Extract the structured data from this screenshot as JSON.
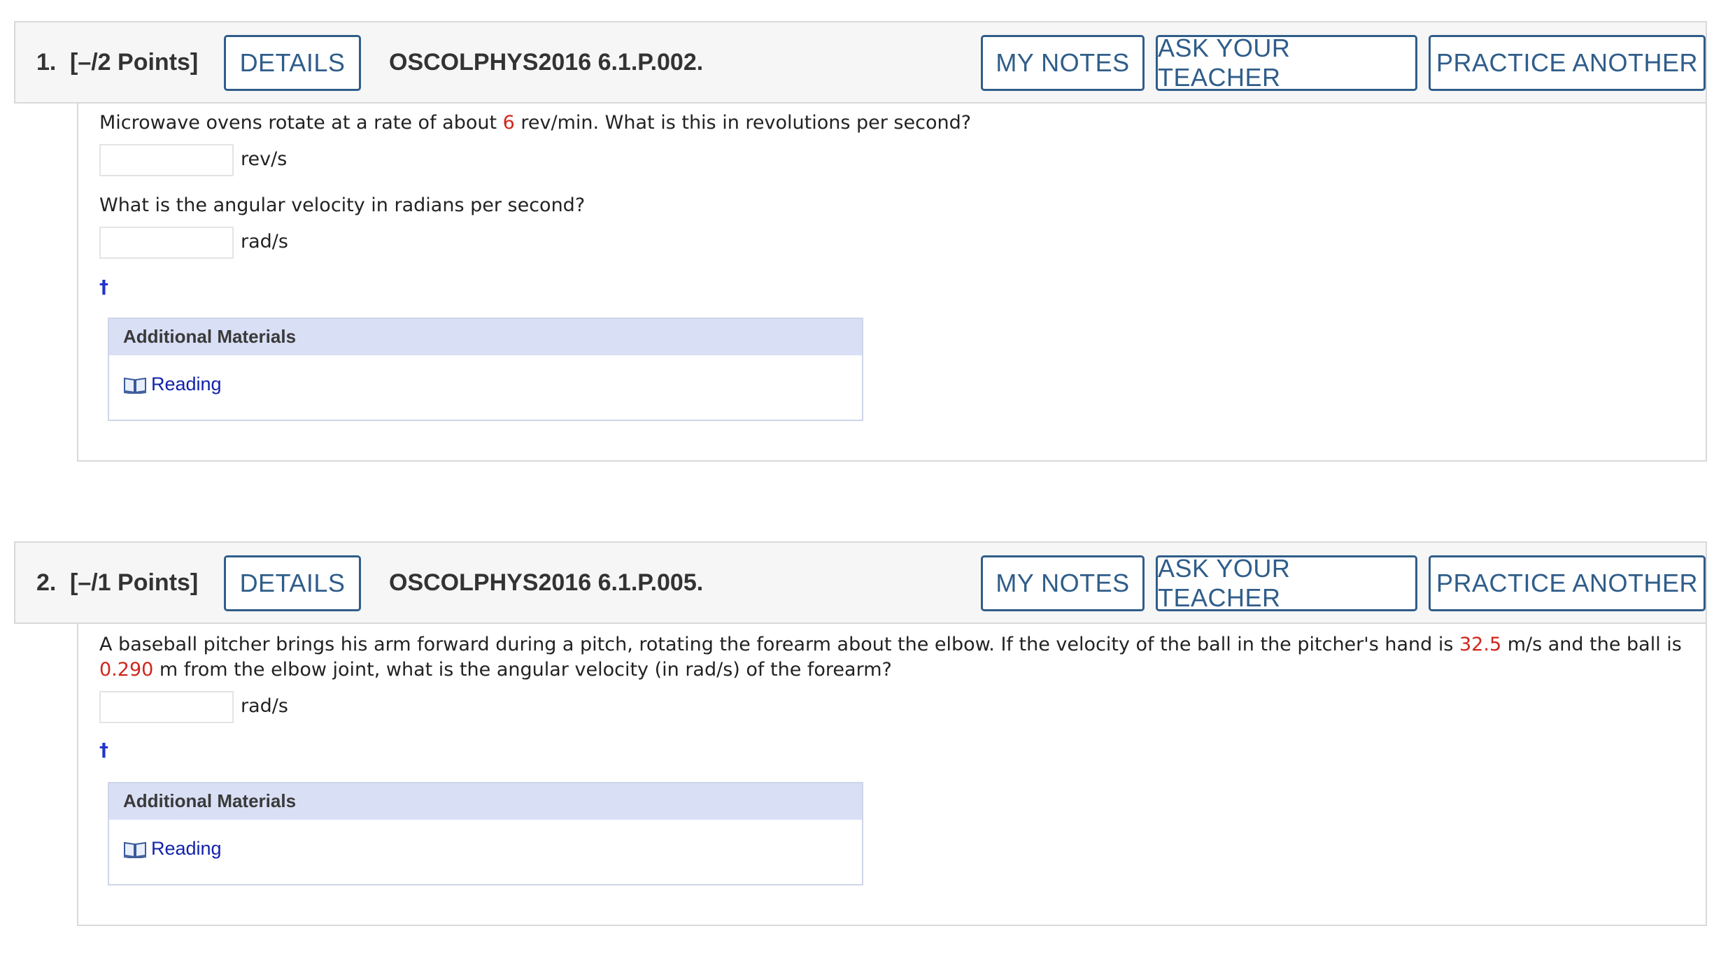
{
  "questions": [
    {
      "number": "1.",
      "points": "[–/2 Points]",
      "details_label": "DETAILS",
      "code": "OSCOLPHYS2016 6.1.P.002.",
      "my_notes_label": "MY NOTES",
      "ask_teacher_label": "ASK YOUR TEACHER",
      "practice_label": "PRACTICE ANOTHER",
      "prompt1": {
        "before": "Microwave ovens rotate at a rate of about ",
        "value": "6",
        "after": " rev/min. What is this in revolutions per second?"
      },
      "input1": {
        "value": "",
        "unit": "rev/s"
      },
      "prompt2": "What is the angular velocity in radians per second?",
      "input2": {
        "value": "",
        "unit": "rad/s"
      },
      "dagger": "†",
      "materials_title": "Additional Materials",
      "reading_label": "Reading"
    },
    {
      "number": "2.",
      "points": "[–/1 Points]",
      "details_label": "DETAILS",
      "code": "OSCOLPHYS2016 6.1.P.005.",
      "my_notes_label": "MY NOTES",
      "ask_teacher_label": "ASK YOUR TEACHER",
      "practice_label": "PRACTICE ANOTHER",
      "prompt": {
        "part1": "A baseball pitcher brings his arm forward during a pitch, rotating the forearm about the elbow. If the velocity of the ball in the pitcher's hand is ",
        "value1": "32.5",
        "part2": " m/s and the ball is ",
        "value2": "0.290",
        "part3": " m from the elbow joint, what is the angular velocity (in rad/s) of the forearm?"
      },
      "input1": {
        "value": "",
        "unit": "rad/s"
      },
      "dagger": "†",
      "materials_title": "Additional Materials",
      "reading_label": "Reading"
    }
  ],
  "icons": {
    "reading": "book-icon"
  },
  "colors": {
    "button_accent": "#2f5d8a",
    "given_value": "#d0261d",
    "link": "#1122aa",
    "materials_header": "#d9dff5"
  }
}
